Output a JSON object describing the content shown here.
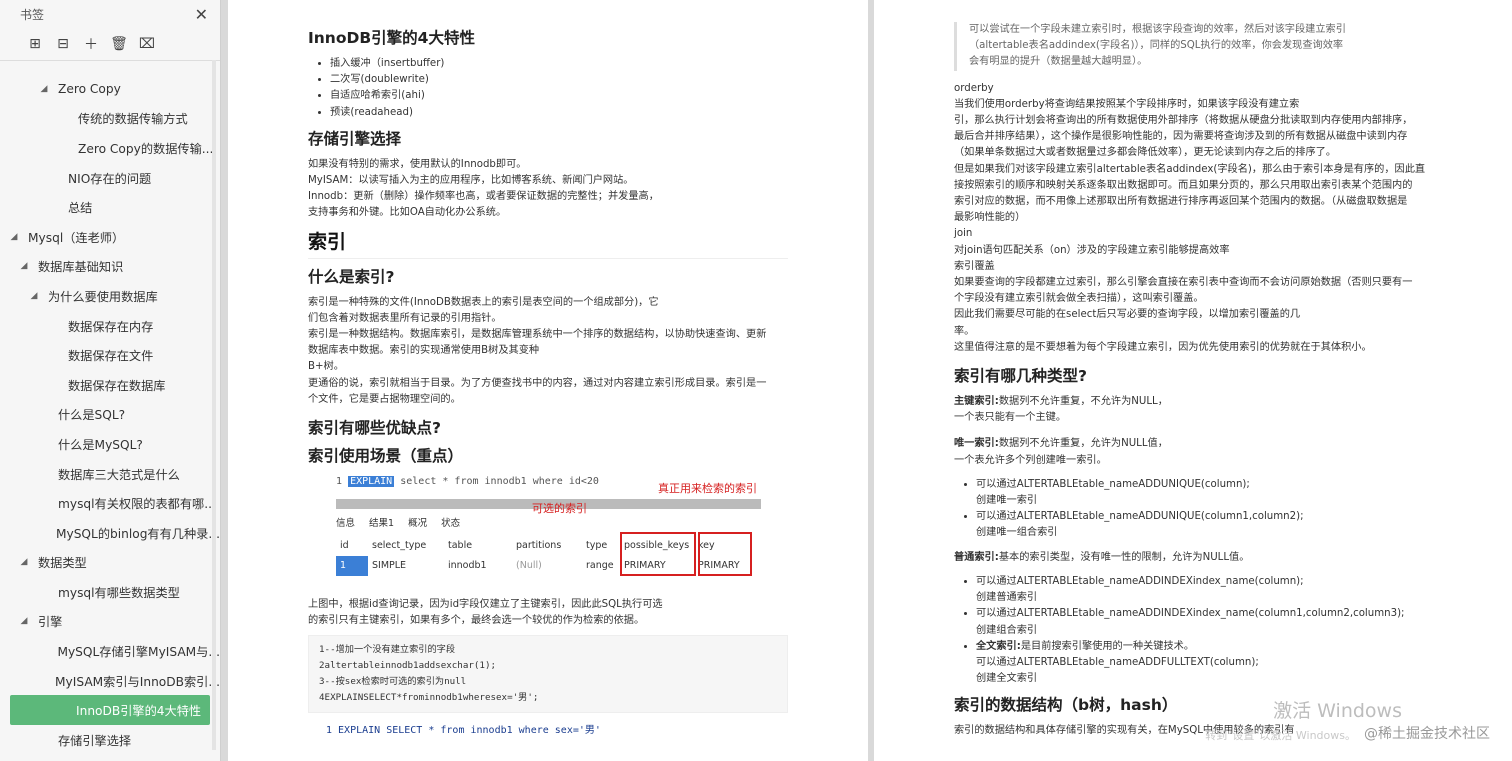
{
  "sidebar": {
    "title": "书签",
    "items": [
      {
        "label": "Zero Copy",
        "level": 3,
        "tri": "◢"
      },
      {
        "label": "传统的数据传输方式",
        "level": 5,
        "tri": ""
      },
      {
        "label": "Zero Copy的数据传输...",
        "level": 5,
        "tri": ""
      },
      {
        "label": "NIO存在的问题",
        "level": 4,
        "tri": ""
      },
      {
        "label": "总结",
        "level": 4,
        "tri": ""
      },
      {
        "label": "Mysql（连老师）",
        "level": 0,
        "tri": "◢"
      },
      {
        "label": "数据库基础知识",
        "level": 1,
        "tri": "◢"
      },
      {
        "label": "为什么要使用数据库",
        "level": 2,
        "tri": "◢"
      },
      {
        "label": "数据保存在内存",
        "level": 4,
        "tri": ""
      },
      {
        "label": "数据保存在文件",
        "level": 4,
        "tri": ""
      },
      {
        "label": "数据保存在数据库",
        "level": 4,
        "tri": ""
      },
      {
        "label": "什么是SQL?",
        "level": 3,
        "tri": ""
      },
      {
        "label": "什么是MySQL?",
        "level": 3,
        "tri": ""
      },
      {
        "label": "数据库三大范式是什么",
        "level": 3,
        "tri": ""
      },
      {
        "label": "mysql有关权限的表都有哪...",
        "level": 3,
        "tri": ""
      },
      {
        "label": "MySQL的binlog有有几种录...",
        "level": 3,
        "tri": ""
      },
      {
        "label": "数据类型",
        "level": 1,
        "tri": "◢"
      },
      {
        "label": "mysql有哪些数据类型",
        "level": 3,
        "tri": ""
      },
      {
        "label": "引擎",
        "level": 1,
        "tri": "◢"
      },
      {
        "label": "MySQL存储引擎MyISAM与...",
        "level": 3,
        "tri": ""
      },
      {
        "label": "MyISAM索引与InnoDB索引...",
        "level": 3,
        "tri": ""
      },
      {
        "label": "InnoDB引擎的4大特性",
        "level": 3,
        "tri": "",
        "active": true
      },
      {
        "label": "存储引擎选择",
        "level": 3,
        "tri": ""
      }
    ]
  },
  "page1": {
    "h_innodb": "InnoDB引擎的4大特性",
    "features": [
      "插入缓冲（insertbuffer)",
      "二次写(doublewrite)",
      "自适应哈希索引(ahi)",
      "预读(readahead)"
    ],
    "h_engine_select": "存储引擎选择",
    "engine_lines": [
      "如果没有特别的需求，使用默认的Innodb即可。",
      "MyISAM：以读写插入为主的应用程序，比如博客系统、新闻门户网站。",
      "Innodb：更新（删除）操作频率也高，或者要保证数据的完整性；并发量高，",
      "支持事务和外键。比如OA自动化办公系统。"
    ],
    "h_index": "索引",
    "h_what_index": "什么是索引?",
    "what_lines": [
      "索引是一种特殊的文件(InnoDB数据表上的索引是表空间的一个组成部分)，它",
      "们包含着对数据表里所有记录的引用指针。",
      "索引是一种数据结构。数据库索引，是数据库管理系统中一个排序的数据结构，以协助快速查询、更新",
      "数据库表中数据。索引的实现通常使用B树及其变种",
      "B+树。",
      "更通俗的说，索引就相当于目录。为了方便查找书中的内容，通过对内容建立索引形成目录。索引是一",
      "个文件，它是要占据物理空间的。"
    ],
    "h_pros_cons": "索引有哪些优缺点?",
    "h_scene": "索引使用场景（重点）",
    "shot": {
      "line_no": "1",
      "sql_kw": "EXPLAIN",
      "sql_rest": "select * from innodb1 where id<20",
      "tabs": [
        "信息",
        "结果1",
        "概况",
        "状态"
      ],
      "headers": [
        "id",
        "select_type",
        "table",
        "partitions",
        "type",
        "possible_keys",
        "key"
      ],
      "row": [
        "1",
        "SIMPLE",
        "innodb1",
        "(Null)",
        "range",
        "PRIMARY",
        "PRIMARY"
      ],
      "label_optional": "可选的索引",
      "label_real": "真正用来检索的索引"
    },
    "after_shot": [
      "上图中，根据id查询记录，因为id字段仅建立了主键索引，因此此SQL执行可选",
      "的索引只有主键索引，如果有多个，最终会选一个较优的作为检索的依据。"
    ],
    "code_lines": [
      "1--增加一个没有建立索引的字段",
      "2altertableinnodb1addsexchar(1);",
      "3--按sex检索时可选的索引为null",
      "4EXPLAINSELECT*frominnodb1wheresex='男';"
    ],
    "code2": "1  EXPLAIN SELECT * from innodb1 where sex='男'"
  },
  "page2": {
    "quote_lines": [
      "可以尝试在一个字段未建立索引时，根据该字段查询的效率，然后对该字段建立索引",
      "（altertable表名addindex(字段名)），同样的SQL执行的效率，你会发现查询效率",
      "会有明显的提升（数据量越大越明显）。"
    ],
    "order_lines": [
      "orderby",
      "当我们使用orderby将查询结果按照某个字段排序时，如果该字段没有建立索",
      "引，那么执行计划会将查询出的所有数据使用外部排序（将数据从硬盘分批读取到内存使用内部排序，",
      "最后合并排序结果），这个操作是很影响性能的，因为需要将查询涉及到的所有数据从磁盘中读到内存",
      "（如果单条数据过大或者数据量过多都会降低效率），更无论读到内存之后的排序了。",
      "但是如果我们对该字段建立索引altertable表名addindex(字段名)，那么由于索引本身是有序的，因此直",
      "接按照索引的顺序和映射关系逐条取出数据即可。而且如果分页的，那么只用取出索引表某个范围内的",
      "索引对应的数据，而不用像上述那取出所有数据进行排序再返回某个范围内的数据。（从磁盘取数据是",
      "最影响性能的）",
      "join",
      "对join语句匹配关系（on）涉及的字段建立索引能够提高效率",
      "索引覆盖",
      "如果要查询的字段都建立过索引，那么引擎会直接在索引表中查询而不会访问原始数据（否则只要有一",
      "个字段没有建立索引就会做全表扫描），这叫索引覆盖。",
      "因此我们需要尽可能的在select后只写必要的查询字段，以增加索引覆盖的几",
      "率。",
      "这里值得注意的是不要想着为每个字段建立索引，因为优先使用索引的优势就在于其体积小。"
    ],
    "h_types": "索引有哪几种类型?",
    "pk_bold": "主键索引:",
    "pk_text": "数据列不允许重复，不允许为NULL，",
    "pk_text2": "一个表只能有一个主键。",
    "uq_bold": "唯一索引:",
    "uq_text": "数据列不允许重复，允许为NULL值，",
    "uq_text2": "一个表允许多个列创建唯一索引。",
    "uq_items": [
      [
        "可以通过ALTERTABLEtable_nameADDUNIQUE(column);",
        "创建唯一索引"
      ],
      [
        "可以通过ALTERTABLEtable_nameADDUNIQUE(column1,column2);",
        "创建唯一组合索引"
      ]
    ],
    "normal_bold": "普通索引:",
    "normal_text": "基本的索引类型，没有唯一性的限制，允许为NULL值。",
    "normal_items": [
      [
        "可以通过ALTERTABLEtable_nameADDINDEXindex_name(column);",
        "创建普通索引"
      ],
      [
        "可以通过ALTERTABLEtable_nameADDINDEXindex_name(column1,column2,column3);",
        "创建组合索引"
      ]
    ],
    "fulltext_bold": "全文索引:",
    "fulltext_text": "是目前搜索引擎使用的一种关键技术。",
    "fulltext_lines": [
      "可以通过ALTERTABLEtable_nameADDFULLTEXT(column);",
      "创建全文索引"
    ],
    "h_structure": "索引的数据结构（b树，hash）",
    "structure_line": "索引的数据结构和具体存储引擎的实现有关，在MySQL中使用较多的索引有"
  },
  "overlay": {
    "win_activate": "激活 Windows",
    "win_sub": "转到\"设置\"以激活 Windows。",
    "juejin": "@稀土掘金技术社区"
  }
}
